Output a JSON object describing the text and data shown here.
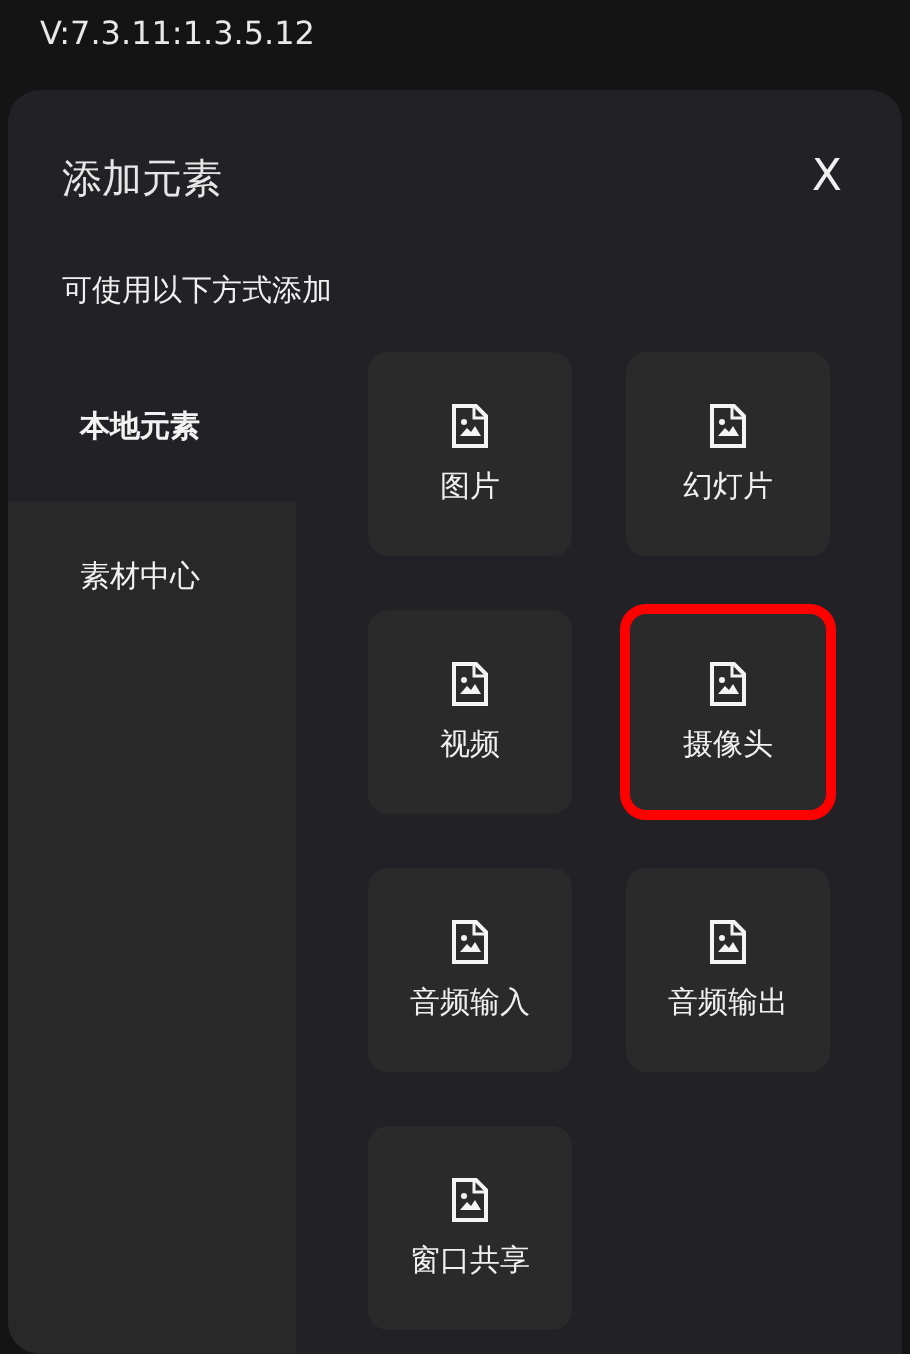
{
  "version": "V:7.3.11:1.3.5.12",
  "dialog": {
    "title": "添加元素",
    "close": "X",
    "subtitle": "可使用以下方式添加"
  },
  "sidebar": {
    "items": [
      {
        "label": "本地元素",
        "selected": true
      },
      {
        "label": "素材中心",
        "selected": false
      }
    ]
  },
  "elements": [
    {
      "label": "图片",
      "highlighted": false
    },
    {
      "label": "幻灯片",
      "highlighted": false
    },
    {
      "label": "视频",
      "highlighted": false
    },
    {
      "label": "摄像头",
      "highlighted": true
    },
    {
      "label": "音频输入",
      "highlighted": false
    },
    {
      "label": "音频输出",
      "highlighted": false
    },
    {
      "label": "窗口共享",
      "highlighted": false
    }
  ]
}
